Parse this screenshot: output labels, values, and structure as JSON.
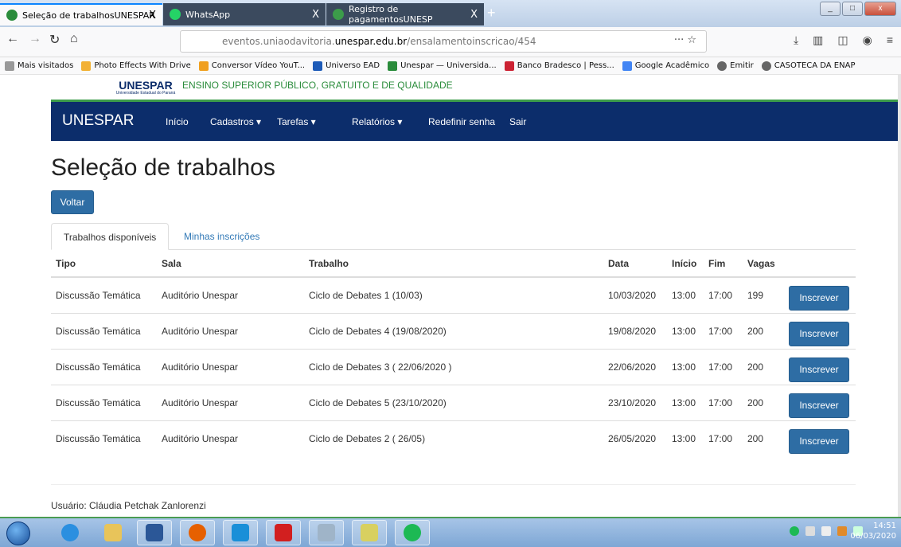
{
  "browser": {
    "tabs": [
      {
        "title": "Seleção de trabalhosUNESPAR",
        "close": "X"
      },
      {
        "title": "WhatsApp",
        "close": "X"
      },
      {
        "title": "Registro de pagamentosUNESP",
        "close": "X"
      }
    ],
    "new_tab": "+",
    "url_prefix": "eventos.uniaodavitoria.",
    "url_host": "unespar.edu.br",
    "url_path": "/ensalamentoinscricao/454",
    "url_actions": "··· ☆",
    "bookmarks": [
      "Mais visitados",
      "Photo Effects With Drive",
      "Conversor Vídeo YouT...",
      "Universo EAD",
      "Unespar — Universida...",
      "Banco Bradesco | Pess...",
      "Google Acadêmico",
      "Emitir",
      "CASOTECA DA ENAP"
    ],
    "colors": {
      "active_tab": "#f9f9fa",
      "inactive_tab": "#3b4a5e",
      "accent": "#0a84ff"
    }
  },
  "site": {
    "logo_text": "UNESPAR",
    "logo_sub": "Universidade Estadual do Paraná",
    "motto": "ENSINO SUPERIOR PÚBLICO, GRATUITO E DE QUALIDADE",
    "nav_brand": "UNESPAR",
    "nav": [
      "Início",
      "Cadastros ▾",
      "Tarefas ▾",
      "Relatórios ▾",
      "Redefinir senha",
      "Sair"
    ],
    "colors": {
      "navbar": "#0c2d6b",
      "motto": "#2a8c3b",
      "button": "#2e6da4",
      "link": "#337ab7"
    }
  },
  "main": {
    "title": "Seleção de trabalhos",
    "back_button": "Voltar",
    "tabs": [
      "Trabalhos disponíveis",
      "Minhas inscrições"
    ],
    "table": {
      "headers": [
        "Tipo",
        "Sala",
        "Trabalho",
        "Data",
        "Início",
        "Fim",
        "Vagas",
        ""
      ],
      "rows": [
        [
          "Discussão Temática",
          "Auditório Unespar",
          "Ciclo de Debates 1 (10/03)",
          "10/03/2020",
          "13:00",
          "17:00",
          "199"
        ],
        [
          "Discussão Temática",
          "Auditório Unespar",
          "Ciclo de Debates 4 (19/08/2020)",
          "19/08/2020",
          "13:00",
          "17:00",
          "200"
        ],
        [
          "Discussão Temática",
          "Auditório Unespar",
          "Ciclo de Debates 3 ( 22/06/2020 )",
          "22/06/2020",
          "13:00",
          "17:00",
          "200"
        ],
        [
          "Discussão Temática",
          "Auditório Unespar",
          "Ciclo de Debates 5 (23/10/2020)",
          "23/10/2020",
          "13:00",
          "17:00",
          "200"
        ],
        [
          "Discussão Temática",
          "Auditório Unespar",
          "Ciclo de Debates 2 ( 26/05)",
          "26/05/2020",
          "13:00",
          "17:00",
          "200"
        ]
      ],
      "action_label": "Inscrever"
    },
    "user_line": "Usuário: Cláudia Petchak Zanlorenzi"
  },
  "taskbar": {
    "time": "14:51",
    "date": "06/03/2020",
    "apps": [
      "internet-explorer",
      "file-explorer",
      "word",
      "firefox",
      "media-player",
      "acrobat",
      "calculator",
      "folder",
      "spotify"
    ]
  }
}
